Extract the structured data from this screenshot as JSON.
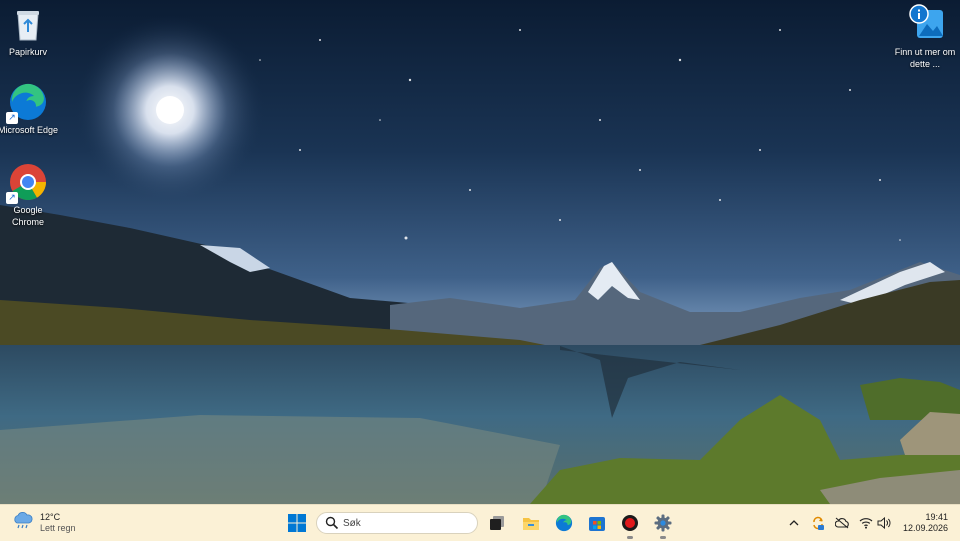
{
  "desktop": {
    "icons": [
      {
        "label": "Papirkurv"
      },
      {
        "label": "Microsoft Edge"
      },
      {
        "label": "Google Chrome"
      },
      {
        "label": "Finn ut mer om dette ..."
      }
    ]
  },
  "taskbar": {
    "weather": {
      "temperature": "12°C",
      "condition": "Lett regn",
      "icon": "cloud-rain-icon"
    },
    "search": {
      "placeholder": "Søk"
    },
    "pinned": [
      {
        "name": "start-button",
        "icon": "windows-logo-icon"
      },
      {
        "name": "task-view-button",
        "icon": "task-view-icon"
      },
      {
        "name": "file-explorer-button",
        "icon": "folder-icon"
      },
      {
        "name": "edge-taskbar-button",
        "icon": "edge-icon"
      },
      {
        "name": "store-taskbar-button",
        "icon": "store-icon"
      },
      {
        "name": "recorder-taskbar-button",
        "icon": "record-icon",
        "running": true
      },
      {
        "name": "settings-taskbar-button",
        "icon": "gear-icon",
        "running": true
      }
    ],
    "tray": [
      "chevron-up-icon",
      "sync-icon",
      "cloud-off-icon",
      "wifi-icon",
      "speaker-icon"
    ],
    "clock": {
      "time": "19:41",
      "date": "12.09.2026"
    },
    "colors": {
      "background": "#fbf1d6",
      "accent": "#0078d4"
    }
  }
}
